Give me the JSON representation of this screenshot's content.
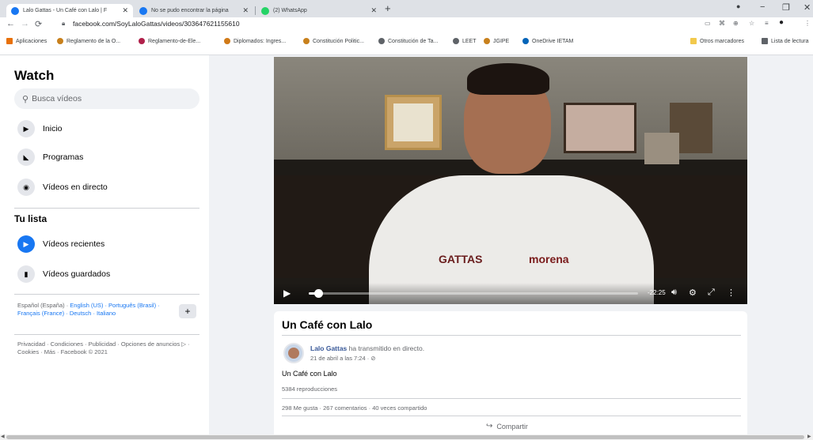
{
  "browser": {
    "tabs": [
      {
        "title": "Lalo Gattas - Un Café con Lalo | F",
        "favicon_color": "#1877f2",
        "close": "✕"
      },
      {
        "title": "No se pudo encontrar la página",
        "favicon_color": "#1877f2",
        "close": "✕"
      },
      {
        "title": "(2) WhatsApp",
        "favicon_color": "#25d366",
        "close": "✕"
      }
    ],
    "new_tab": "+",
    "window_controls": {
      "minimize": "−",
      "maximize": "❐",
      "close": "✕"
    },
    "url": "facebook.com/SoyLaloGattas/videos/303647621155610",
    "bookmarks": [
      {
        "label": "Aplicaciones",
        "color": "#e8710a"
      },
      {
        "label": "Reglamento de la O...",
        "color": "#c8801c"
      },
      {
        "label": "Reglamento-de-Ele...",
        "color": "#b0204a"
      },
      {
        "label": "Diplomados: Ingres...",
        "color": "#d07a18"
      },
      {
        "label": "Constitución Politic...",
        "color": "#c8801c"
      },
      {
        "label": "Constitución de Ta...",
        "color": "#5f6368"
      },
      {
        "label": "LEET",
        "color": "#5f6368"
      },
      {
        "label": "JGIPE",
        "color": "#c8801c"
      },
      {
        "label": "OneDrive IETAM",
        "color": "#0364b8"
      }
    ],
    "bookmarks_right": [
      {
        "label": "Otros marcadores",
        "color": "#f2c94c"
      },
      {
        "label": "Lista de lectura",
        "color": "#5f6368"
      }
    ]
  },
  "sidebar": {
    "title": "Watch",
    "search_placeholder": "Busca vídeos",
    "items": [
      {
        "label": "Inicio",
        "icon": "▶"
      },
      {
        "label": "Programas",
        "icon": "◣"
      },
      {
        "label": "Vídeos en directo",
        "icon": "◉"
      }
    ],
    "list_title": "Tu lista",
    "list_items": [
      {
        "label": "Vídeos recientes",
        "icon": "▶"
      },
      {
        "label": "Vídeos guardados",
        "icon": "▮"
      }
    ],
    "languages_current": "Español (España)",
    "languages": "English (US) · Português (Brasil) · Français (France) · Deutsch · Italiano",
    "add_language": "+",
    "footer": "Privacidad · Condiciones · Publicidad · Opciones de anuncios ▷ · Cookies · Más · Facebook © 2021"
  },
  "video": {
    "time_remaining": "-22:25",
    "progress_fraction": 0.03,
    "shirt_text_left": "GATTAS",
    "shirt_text_right": "morena"
  },
  "post": {
    "title": "Un Café con Lalo",
    "author": "Lalo Gattas",
    "action": "ha transmitido en directo.",
    "date": "21 de abril a las 7:24 · ⊘",
    "text": "Un Café con Lalo",
    "views": "5384 reproducciones",
    "stats": "298 Me gusta · 267 comentarios · 40 veces compartido",
    "share_label": "Compartir"
  }
}
